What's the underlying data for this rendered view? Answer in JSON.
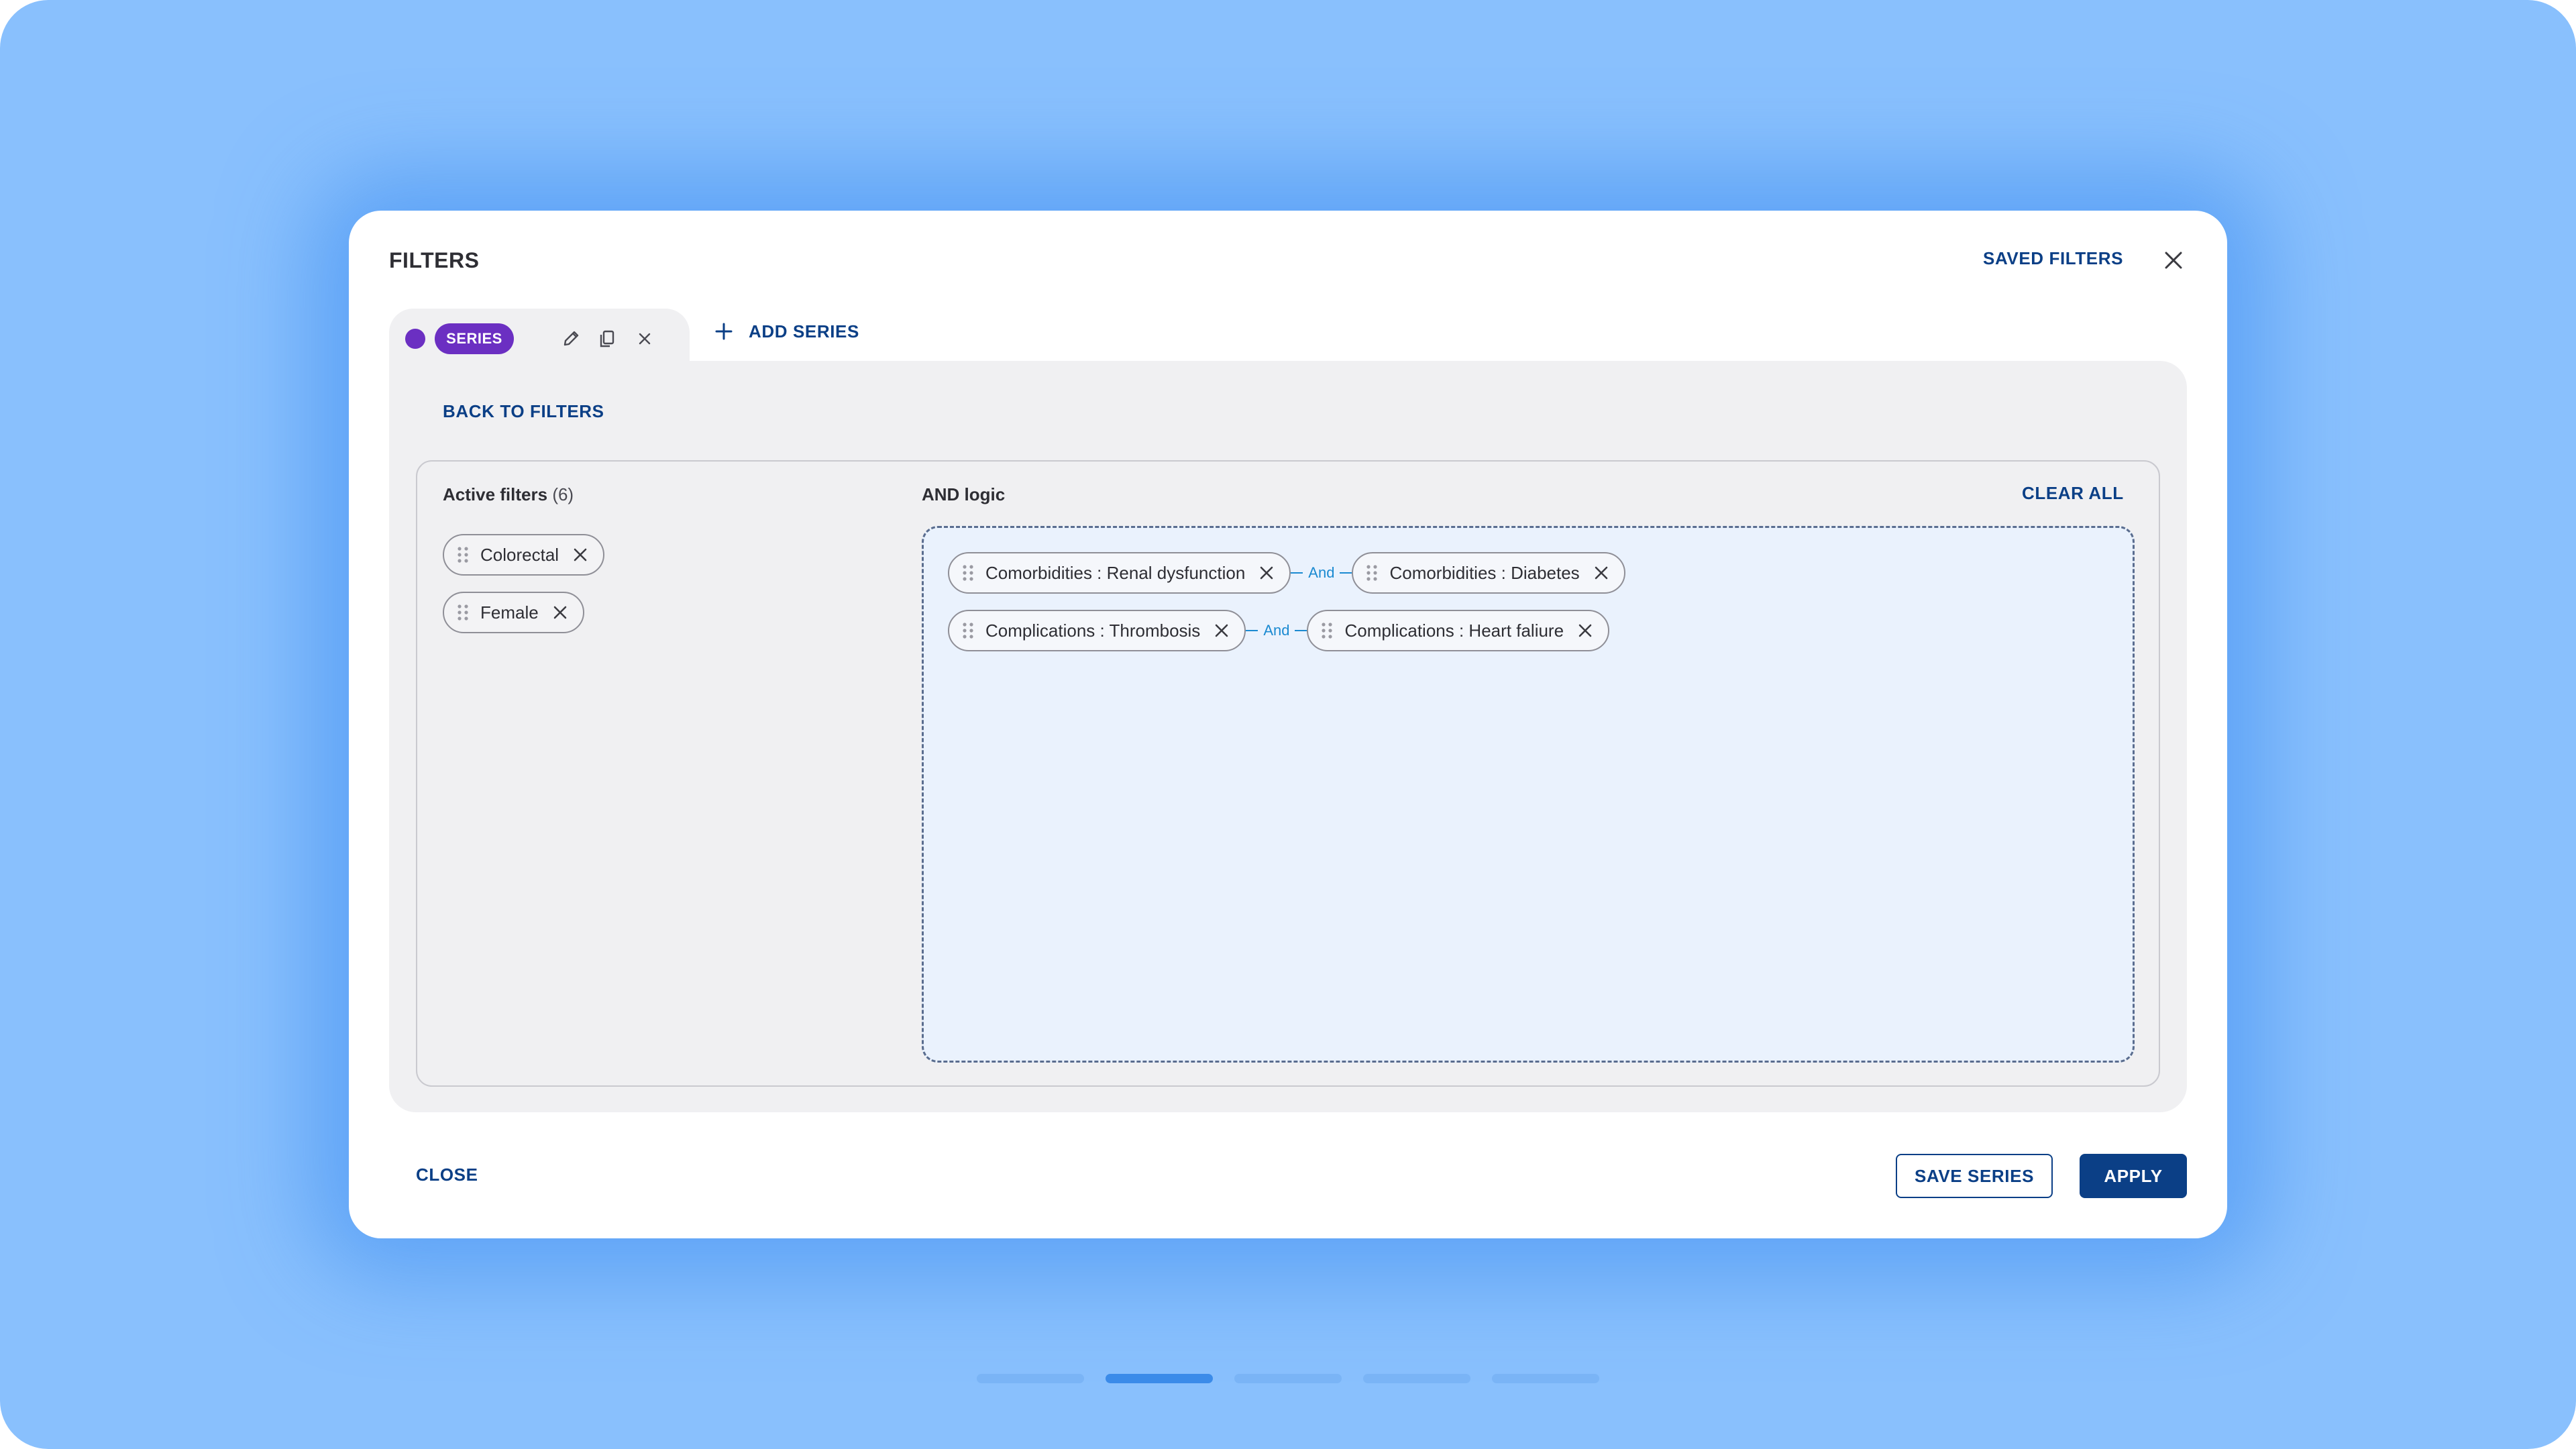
{
  "modal": {
    "title": "FILTERS",
    "saved_filters_label": "SAVED FILTERS"
  },
  "tab": {
    "badge": "SERIES",
    "color": "#6b2fc2",
    "icons": [
      "pencil-icon",
      "copy-icon",
      "close-icon"
    ]
  },
  "add_series_label": "ADD SERIES",
  "panel": {
    "back_label": "BACK TO FILTERS",
    "active_filters": {
      "title": "Active filters",
      "count": "(6)",
      "chips": [
        {
          "label": "Colorectal"
        },
        {
          "label": "Female"
        }
      ]
    },
    "logic": {
      "title": "AND logic",
      "clear_all_label": "CLEAR ALL",
      "rows": [
        {
          "left": "Comorbidities : Renal dysfunction",
          "connector": "And",
          "right": "Comorbidities : Diabetes"
        },
        {
          "left": "Complications : Thrombosis",
          "connector": "And",
          "right": "Complications : Heart faliure"
        }
      ]
    }
  },
  "footer": {
    "close_label": "CLOSE",
    "save_series_label": "SAVE SERIES",
    "apply_label": "APPLY"
  },
  "pager": {
    "count": 5,
    "active_index": 1
  },
  "colors": {
    "background": "#89c0fd",
    "accent": "#0b3f86",
    "series": "#6b2fc2",
    "connector": "#1b8ad1"
  }
}
